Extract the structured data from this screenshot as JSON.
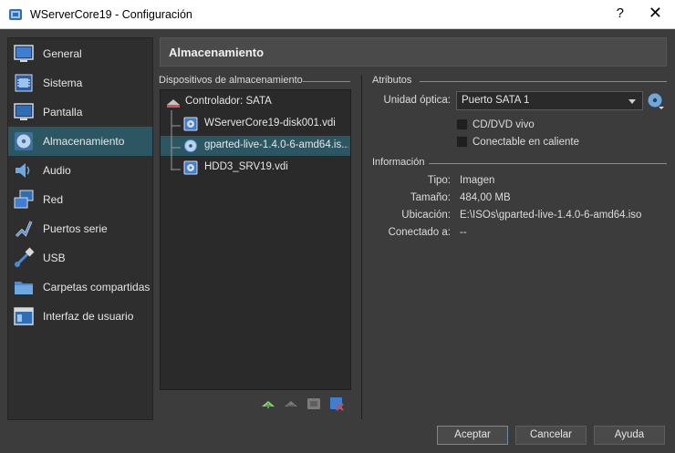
{
  "window": {
    "title": "WServerCore19 - Configuración",
    "help_glyph": "?",
    "close_glyph": "✕"
  },
  "sidebar": {
    "items": [
      {
        "label": "General",
        "icon": "general-icon",
        "selected": false
      },
      {
        "label": "Sistema",
        "icon": "system-icon",
        "selected": false
      },
      {
        "label": "Pantalla",
        "icon": "display-icon",
        "selected": false
      },
      {
        "label": "Almacenamiento",
        "icon": "storage-icon",
        "selected": true
      },
      {
        "label": "Audio",
        "icon": "audio-icon",
        "selected": false
      },
      {
        "label": "Red",
        "icon": "network-icon",
        "selected": false
      },
      {
        "label": "Puertos serie",
        "icon": "serial-ports-icon",
        "selected": false
      },
      {
        "label": "USB",
        "icon": "usb-icon",
        "selected": false
      },
      {
        "label": "Carpetas compartidas",
        "icon": "shared-folders-icon",
        "selected": false
      },
      {
        "label": "Interfaz de usuario",
        "icon": "user-interface-icon",
        "selected": false
      }
    ]
  },
  "page": {
    "title": "Almacenamiento"
  },
  "storage": {
    "group_title": "Dispositivos de almacenamiento",
    "controller": "Controlador: SATA",
    "devices": [
      {
        "label": "WServerCore19-disk001.vdi",
        "type": "hard-disk",
        "selected": false
      },
      {
        "label": "gparted-live-1.4.0-6-amd64.is...",
        "type": "optical-disc",
        "selected": true
      },
      {
        "label": "HDD3_SRV19.vdi",
        "type": "hard-disk",
        "selected": false
      }
    ]
  },
  "attributes": {
    "group_title": "Atributos",
    "optical_drive_label": "Unidad óptica:",
    "optical_drive_value": "Puerto SATA 1",
    "live_cd_label": "CD/DVD vivo",
    "live_cd_checked": false,
    "hot_plug_label": "Conectable en caliente",
    "hot_plug_checked": false
  },
  "information": {
    "group_title": "Información",
    "type_label": "Tipo:",
    "type_value": "Imagen",
    "size_label": "Tamaño:",
    "size_value": "484,00 MB",
    "location_label": "Ubicación:",
    "location_value": "E:\\ISOs\\gparted-live-1.4.0-6-amd64.iso",
    "attached_label": "Conectado a:",
    "attached_value": "--"
  },
  "buttons": {
    "accept": "Aceptar",
    "cancel": "Cancelar",
    "help": "Ayuda"
  },
  "colors": {
    "selection": "#2d5663",
    "background": "#3c3c3c",
    "panel": "#2a2a2a"
  }
}
